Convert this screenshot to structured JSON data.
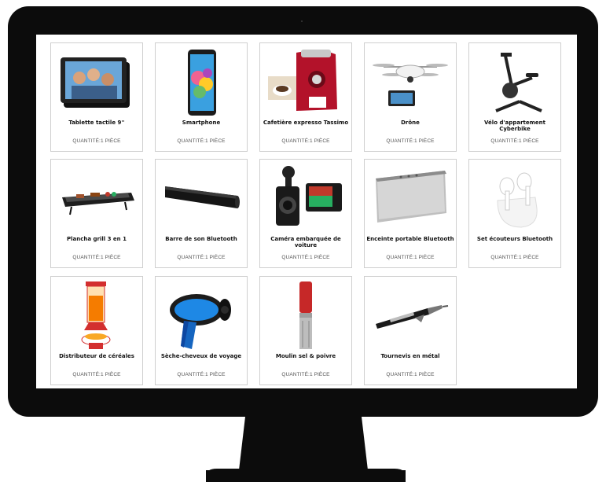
{
  "products": [
    {
      "name": "Tablette tactile 9''",
      "qty": "QUANTITÉ:1 PIÈCE",
      "icon": "tablet-icon"
    },
    {
      "name": "Smartphone",
      "qty": "QUANTITÉ:1 PIÈCE",
      "icon": "smartphone-icon"
    },
    {
      "name": "Cafetière expresso Tassimo",
      "qty": "QUANTITÉ:1 PIÈCE",
      "icon": "coffee-machine-icon"
    },
    {
      "name": "Drône",
      "qty": "QUANTITÉ:1 PIÈCE",
      "icon": "drone-icon"
    },
    {
      "name": "Vélo d'appartement Cyberbike",
      "qty": "QUANTITÉ:1 PIÈCE",
      "icon": "exercise-bike-icon"
    },
    {
      "name": "Plancha grill 3 en 1",
      "qty": "QUANTITÉ:1 PIÈCE",
      "icon": "grill-icon"
    },
    {
      "name": "Barre de son Bluetooth",
      "qty": "QUANTITÉ:1 PIÈCE",
      "icon": "soundbar-icon"
    },
    {
      "name": "Caméra embarquée de voiture",
      "qty": "QUANTITÉ:1 PIÈCE",
      "icon": "dashcam-icon"
    },
    {
      "name": "Enceinte portable Bluetooth",
      "qty": "QUANTITÉ:1 PIÈCE",
      "icon": "speaker-icon"
    },
    {
      "name": "Set écouteurs Bluetooth",
      "qty": "QUANTITÉ:1 PIÈCE",
      "icon": "earbuds-icon"
    },
    {
      "name": "Distributeur de céréales",
      "qty": "QUANTITÉ:1 PIÈCE",
      "icon": "cereal-dispenser-icon"
    },
    {
      "name": "Sèche-cheveux de voyage",
      "qty": "QUANTITÉ:1 PIÈCE",
      "icon": "hair-dryer-icon"
    },
    {
      "name": "Moulin sel & poivre",
      "qty": "QUANTITÉ:1 PIÈCE",
      "icon": "salt-pepper-mill-icon"
    },
    {
      "name": "Tournevis en métal",
      "qty": "QUANTITÉ:1 PIÈCE",
      "icon": "screwdriver-icon"
    }
  ],
  "colors": {
    "frame": "#0c0c0c",
    "card_border": "#cfcfcf",
    "screen_bg": "#ffffff"
  }
}
